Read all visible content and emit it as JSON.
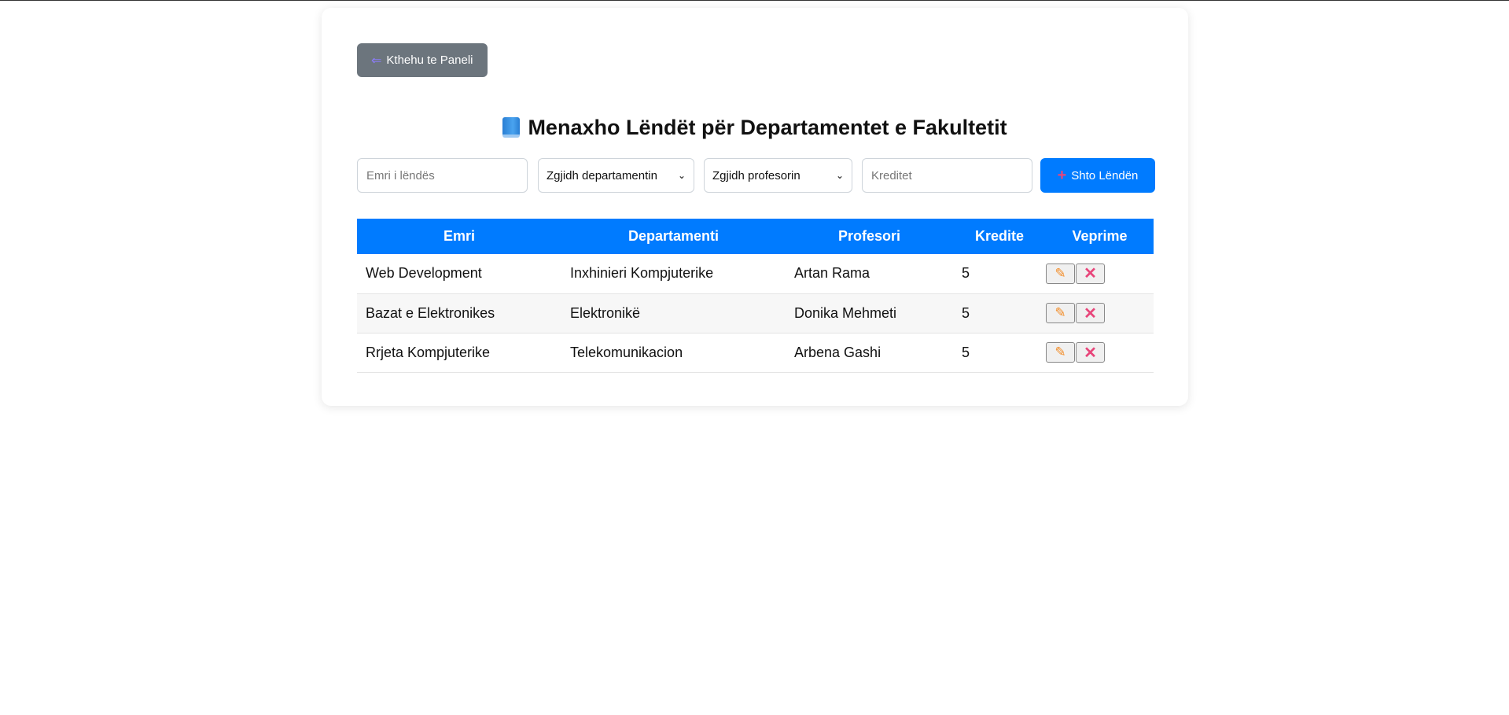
{
  "back_button": {
    "label": "Kthehu te Paneli",
    "icon": "arrow-left-icon"
  },
  "page_title": "Menaxho Lëndët për Departamentet e Fakultetit",
  "title_icon": "blue-book-icon",
  "form": {
    "subject_name_placeholder": "Emri i lëndës",
    "department_select": "Zgjidh departamentin",
    "professor_select": "Zgjidh profesorin",
    "credits_placeholder": "Kreditet",
    "add_button": "Shto Lëndën"
  },
  "table": {
    "headers": [
      "Emri",
      "Departamenti",
      "Profesori",
      "Kredite",
      "Veprime"
    ],
    "rows": [
      {
        "name": "Web Development",
        "department": "Inxhinieri Kompjuterike",
        "professor": "Artan Rama",
        "credits": "5"
      },
      {
        "name": "Bazat e Elektronikes",
        "department": "Elektronikë",
        "professor": "Donika Mehmeti",
        "credits": "5"
      },
      {
        "name": "Rrjeta Kompjuterike",
        "department": "Telekomunikacion",
        "professor": "Arbena Gashi",
        "credits": "5"
      }
    ]
  },
  "colors": {
    "primary": "#007bff",
    "secondary": "#6c757d",
    "edit_icon": "#f28c28",
    "delete_icon": "#e8457a"
  }
}
